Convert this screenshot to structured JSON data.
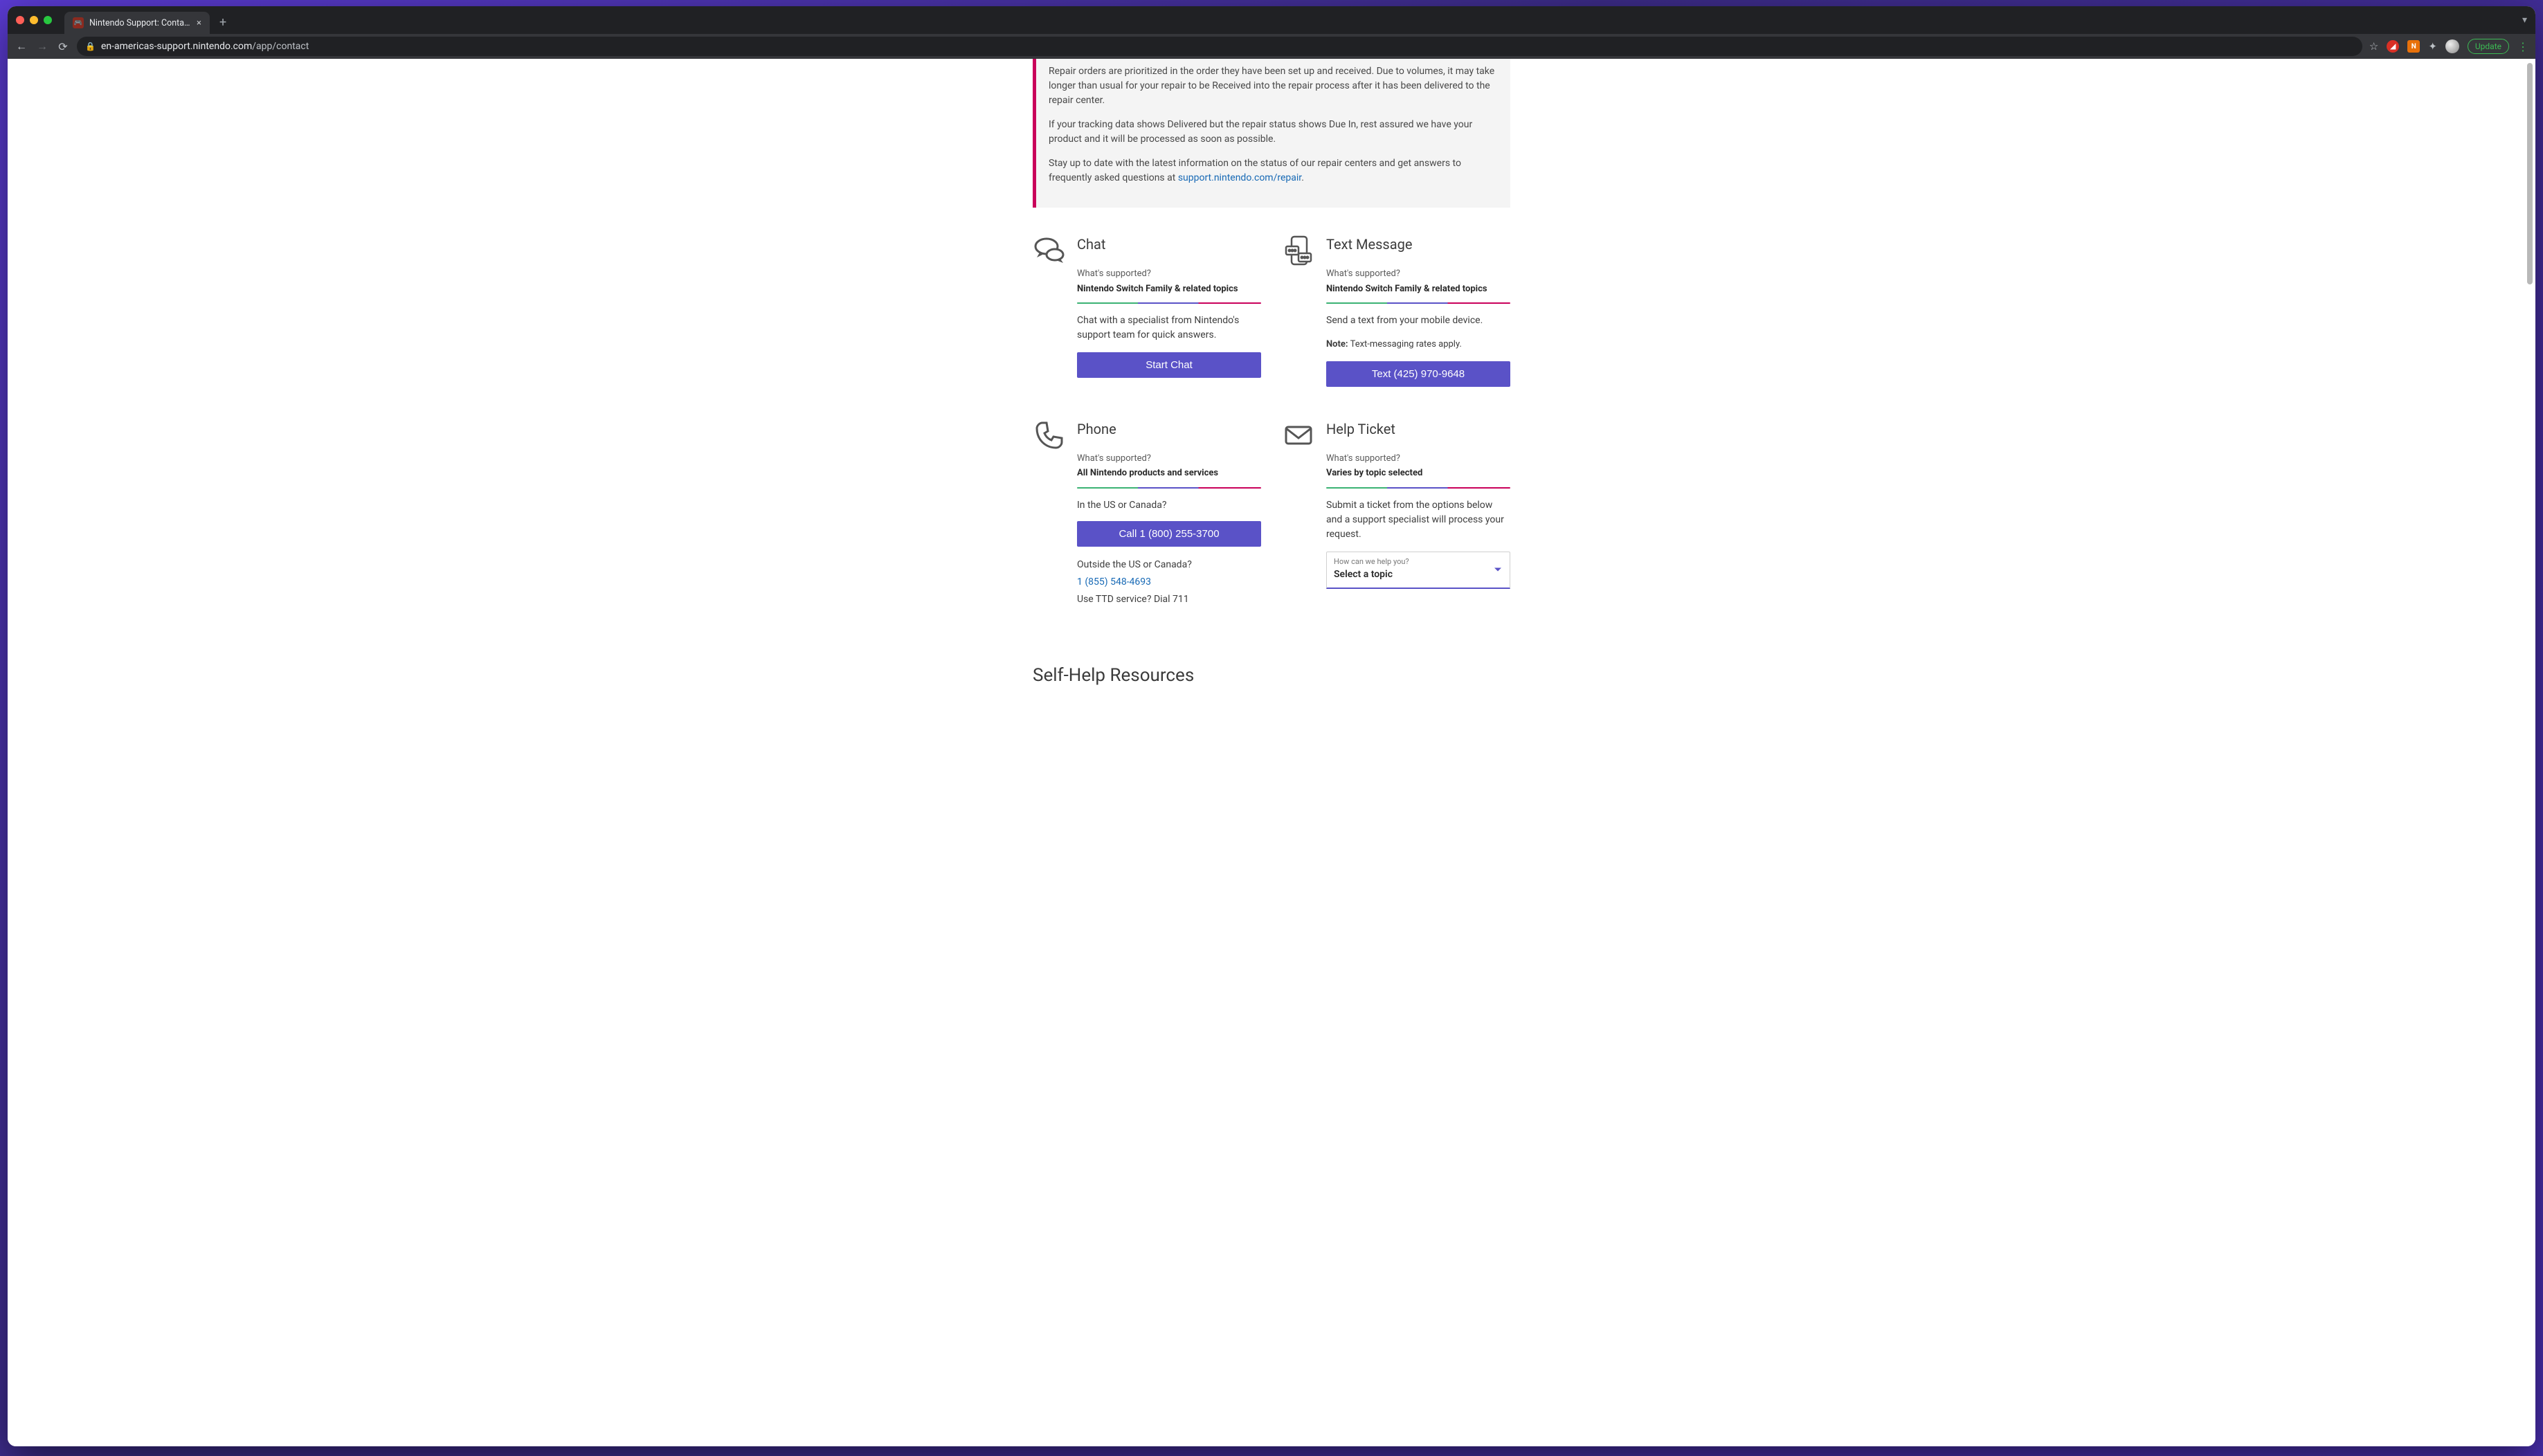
{
  "browser": {
    "tab_title": "Nintendo Support: Contact Us",
    "url_domain": "en-americas-support.nintendo.com",
    "url_path": "/app/contact",
    "update_label": "Update"
  },
  "notice": {
    "p1": "Repair orders are prioritized in the order they have been set up and received. Due to volumes, it may take longer than usual for your repair to be Received into the repair process after it has been delivered to the repair center.",
    "p2": "If your tracking data shows Delivered but the repair status shows Due In, rest assured we have your product and it will be processed as soon as possible.",
    "p3_pre": "Stay up to date with the latest information on the status of our repair centers and get answers to frequently asked questions at ",
    "p3_link": "support.nintendo.com/repair",
    "p3_post": "."
  },
  "supported_q": "What's supported?",
  "cards": {
    "chat": {
      "title": "Chat",
      "supported": "Nintendo Switch Family & related topics",
      "desc": "Chat with a specialist from Nintendo's support team for quick answers.",
      "button": "Start Chat"
    },
    "text": {
      "title": "Text Message",
      "supported": "Nintendo Switch Family & related topics",
      "desc": "Send a text from your mobile device.",
      "note_label": "Note:",
      "note_text": " Text-messaging rates apply.",
      "button": "Text (425) 970-9648"
    },
    "phone": {
      "title": "Phone",
      "supported": "All Nintendo products and services",
      "q_us": "In the US or Canada?",
      "button": "Call 1 (800) 255-3700",
      "q_out": "Outside the US or Canada?",
      "intl_number": "1 (855) 548-4693",
      "tty": "Use TTD service? Dial 711"
    },
    "ticket": {
      "title": "Help Ticket",
      "supported": "Varies by topic selected",
      "desc": "Submit a ticket from the options below and a support specialist will process your request.",
      "select_label": "How can we help you?",
      "select_value": "Select a topic"
    }
  },
  "selfhelp_heading": "Self-Help Resources"
}
